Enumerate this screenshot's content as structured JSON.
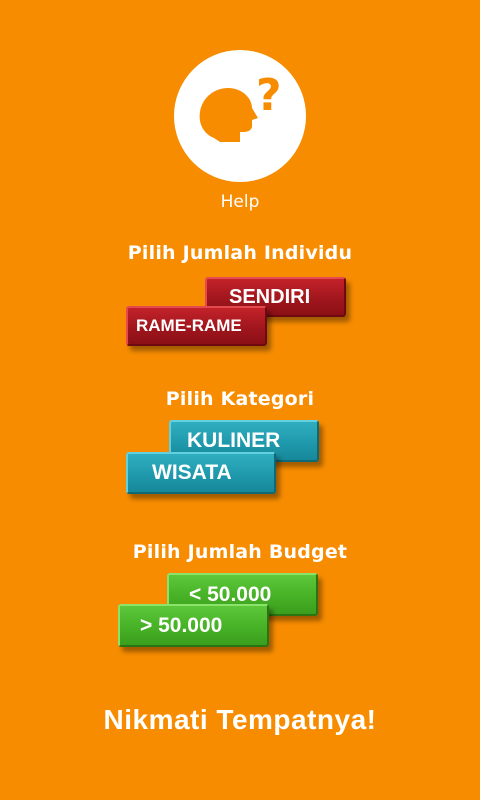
{
  "help": {
    "label": "Help",
    "icon": "head-question-icon"
  },
  "individu": {
    "title": "Pilih Jumlah Individu",
    "sendiri": "SENDIRI",
    "rame": "RAME-RAME"
  },
  "kategori": {
    "title": "Pilih Kategori",
    "kuliner": "KULINER",
    "wisata": "WISATA"
  },
  "budget": {
    "title": "Pilih Jumlah Budget",
    "under": "< 50.000",
    "over": "> 50.000"
  },
  "footer": {
    "text": "Nikmati Tempatnya!"
  },
  "colors": {
    "background": "#F78C00",
    "red_button": "#A1161D",
    "teal_button": "#1E97AA",
    "green_button": "#45AF25"
  }
}
